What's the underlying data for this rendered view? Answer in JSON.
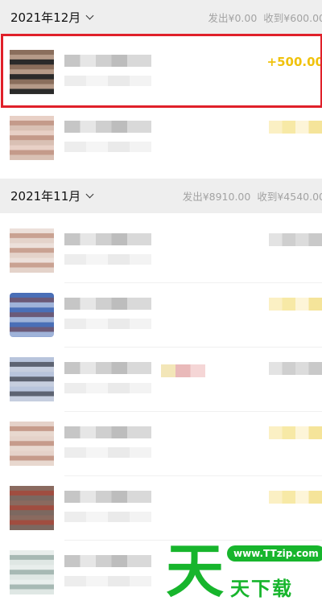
{
  "sections": [
    {
      "month": "2021年12月",
      "stats": {
        "out": "发出¥0.00",
        "in": "收到¥600.00"
      }
    },
    {
      "month": "2021年11月",
      "stats": {
        "out": "发出¥8910.00",
        "in": "收到¥4540.00"
      }
    }
  ],
  "highlighted_transaction": {
    "amount": "+500.00"
  },
  "watermark": {
    "big_char": "天",
    "url": "www.TTzip.com",
    "text": "天下载"
  },
  "colors": {
    "highlight_border": "#e0202a",
    "income_amount": "#f0c20c",
    "watermark": "#17b52c"
  }
}
